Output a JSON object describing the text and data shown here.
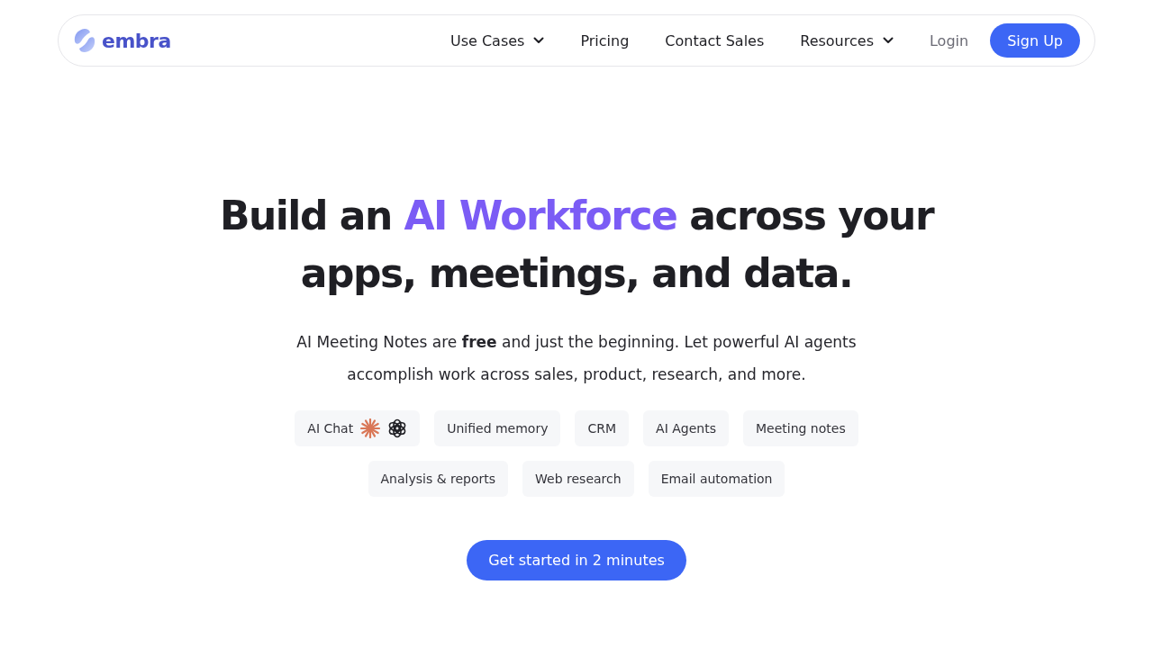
{
  "brand": {
    "name": "embra"
  },
  "nav": [
    {
      "label": "Use Cases",
      "kind": "dropdown"
    },
    {
      "label": "Pricing",
      "kind": "link"
    },
    {
      "label": "Contact Sales",
      "kind": "link"
    },
    {
      "label": "Resources",
      "kind": "dropdown"
    },
    {
      "label": "Login",
      "kind": "login"
    },
    {
      "label": "Sign Up",
      "kind": "primary"
    }
  ],
  "headline": [
    {
      "text": "Build an ",
      "highlight": false
    },
    {
      "text": "AI Workforce",
      "highlight": true
    },
    {
      "text": " across your apps, meetings, and data.",
      "highlight": false
    }
  ],
  "subtitle": "AI Meeting Notes are **free** and just the beginning. Let powerful AI agents accomplish work across sales, product, research, and more.",
  "tags": [
    {
      "label": "AI Chat",
      "kind": "models"
    },
    {
      "label": "Unified memory",
      "kind": "plain"
    },
    {
      "label": "CRM",
      "kind": "plain"
    },
    {
      "label": "AI Agents",
      "kind": "plain"
    },
    {
      "label": "Meeting notes",
      "kind": "plain"
    },
    {
      "label": "Analysis & reports",
      "kind": "plain"
    },
    {
      "label": "Web research",
      "kind": "plain"
    },
    {
      "label": "Email automation",
      "kind": "plain"
    }
  ],
  "cta": {
    "label": "Get started in 2 minutes"
  }
}
